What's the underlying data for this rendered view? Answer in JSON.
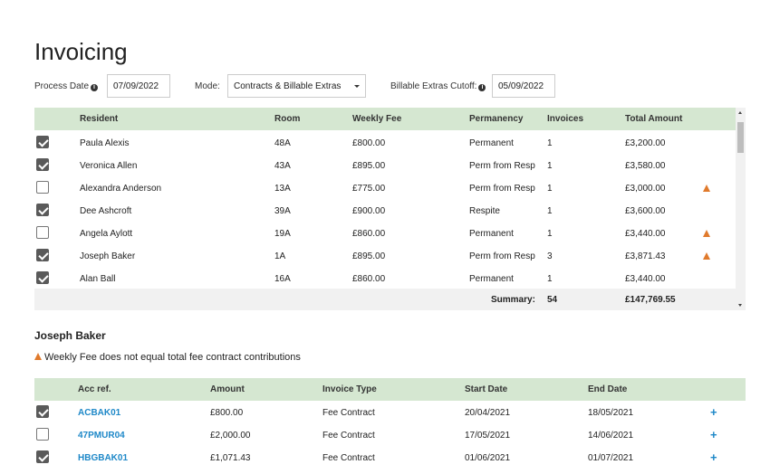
{
  "page": {
    "title": "Invoicing"
  },
  "filters": {
    "process_date_label": "Process Date",
    "process_date_value": "07/09/2022",
    "mode_label": "Mode:",
    "mode_value": "Contracts & Billable Extras",
    "cutoff_label": "Billable Extras Cutoff:",
    "cutoff_value": "05/09/2022"
  },
  "residents_table": {
    "columns": {
      "resident": "Resident",
      "room": "Room",
      "weekly_fee": "Weekly Fee",
      "permanency": "Permanency",
      "invoices": "Invoices",
      "total_amount": "Total Amount"
    },
    "rows": [
      {
        "checked": true,
        "resident": "Paula Alexis",
        "room": "48A",
        "weekly_fee": "£800.00",
        "permanency": "Permanent",
        "invoices": "1",
        "total_amount": "£3,200.00",
        "warning": false
      },
      {
        "checked": true,
        "resident": "Veronica Allen",
        "room": "43A",
        "weekly_fee": "£895.00",
        "permanency": "Perm from Resp",
        "invoices": "1",
        "total_amount": "£3,580.00",
        "warning": false
      },
      {
        "checked": false,
        "resident": "Alexandra Anderson",
        "room": "13A",
        "weekly_fee": "£775.00",
        "permanency": "Perm from Resp",
        "invoices": "1",
        "total_amount": "£3,000.00",
        "warning": true
      },
      {
        "checked": true,
        "resident": "Dee Ashcroft",
        "room": "39A",
        "weekly_fee": "£900.00",
        "permanency": "Respite",
        "invoices": "1",
        "total_amount": "£3,600.00",
        "warning": false
      },
      {
        "checked": false,
        "resident": "Angela Aylott",
        "room": "19A",
        "weekly_fee": "£860.00",
        "permanency": "Permanent",
        "invoices": "1",
        "total_amount": "£3,440.00",
        "warning": true
      },
      {
        "checked": true,
        "resident": "Joseph Baker",
        "room": "1A",
        "weekly_fee": "£895.00",
        "permanency": "Perm from Resp",
        "invoices": "3",
        "total_amount": "£3,871.43",
        "warning": true
      },
      {
        "checked": true,
        "resident": "Alan Ball",
        "room": "16A",
        "weekly_fee": "£860.00",
        "permanency": "Permanent",
        "invoices": "1",
        "total_amount": "£3,440.00",
        "warning": false
      }
    ],
    "summary": {
      "label": "Summary:",
      "invoices": "54",
      "total_amount": "£147,769.55"
    }
  },
  "detail": {
    "resident_name": "Joseph Baker",
    "warning_text": "Weekly Fee does not equal total fee contract contributions",
    "columns": {
      "acc_ref": "Acc ref.",
      "amount": "Amount",
      "invoice_type": "Invoice Type",
      "start_date": "Start Date",
      "end_date": "End Date"
    },
    "rows": [
      {
        "checked": true,
        "acc_ref": "ACBAK01",
        "amount": "£800.00",
        "invoice_type": "Fee Contract",
        "start_date": "20/04/2021",
        "end_date": "18/05/2021",
        "action": "+"
      },
      {
        "checked": false,
        "acc_ref": "47PMUR04",
        "amount": "£2,000.00",
        "invoice_type": "Fee Contract",
        "start_date": "17/05/2021",
        "end_date": "14/06/2021",
        "action": "+"
      },
      {
        "checked": true,
        "acc_ref": "HBGBAK01",
        "amount": "£1,071.43",
        "invoice_type": "Fee Contract",
        "start_date": "01/06/2021",
        "end_date": "01/07/2021",
        "action": "+"
      }
    ]
  },
  "colors": {
    "header_green": "#d5e7d1",
    "link_blue": "#1e88c8",
    "warning_orange": "#e07a2c",
    "checkbox_dark": "#5a5a5a"
  }
}
